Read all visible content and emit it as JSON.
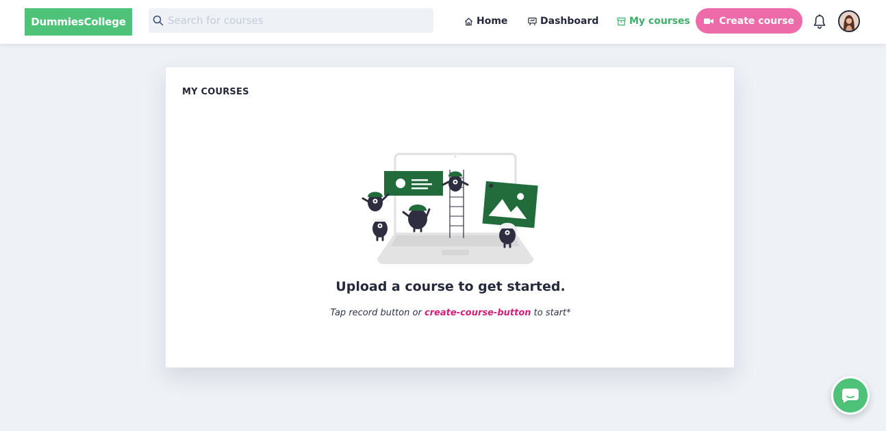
{
  "app": {
    "logo_text": "DummiesCollege",
    "brand_color": "#4fc27a",
    "accent_color": "#ec6ba8"
  },
  "search": {
    "placeholder": "Search for courses",
    "value": "",
    "icon": "search-icon"
  },
  "nav": {
    "home": {
      "label": "Home",
      "icon": "home-icon"
    },
    "dashboard": {
      "label": "Dashboard",
      "icon": "dashboard-icon"
    },
    "my_courses": {
      "label": "My courses",
      "icon": "archive-icon",
      "active": true
    }
  },
  "create_button": {
    "label": "Create course",
    "icon": "video-camera-icon"
  },
  "notifications": {
    "icon": "bell-icon"
  },
  "user": {
    "avatar_icon": "avatar"
  },
  "main": {
    "title": "MY COURSES",
    "empty_state": {
      "heading": "Upload a course to get started.",
      "sub_before": "Tap record button or ",
      "sub_link": "create-course-button",
      "sub_after": " to start*"
    }
  },
  "chat": {
    "icon": "chat-bubble-icon"
  }
}
